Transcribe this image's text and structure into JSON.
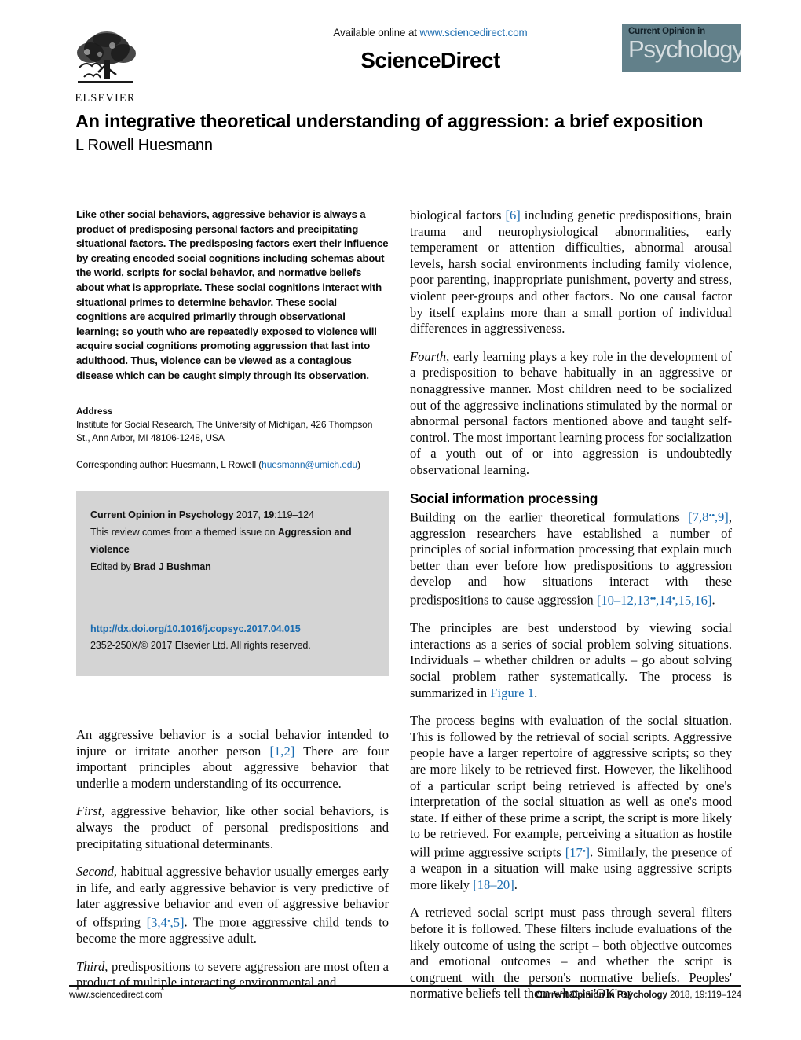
{
  "masthead": {
    "available_text": "Available online at ",
    "available_url": "www.sciencedirect.com",
    "sciencedirect_wordmark": "ScienceDirect",
    "elsevier_wordmark": "ELSEVIER",
    "journal_logo_top": "Current Opinion in",
    "journal_logo_main": "Psychology",
    "journal_logo_bg": "#62808a",
    "link_color": "#1b6cb0"
  },
  "title_block": {
    "title": "An integrative theoretical understanding of aggression: a brief exposition",
    "author": "L Rowell Huesmann"
  },
  "abstract": {
    "text": "Like other social behaviors, aggressive behavior is always a product of predisposing personal factors and precipitating situational factors. The predisposing factors exert their influence by creating encoded social cognitions including schemas about the world, scripts for social behavior, and normative beliefs about what is appropriate. These social cognitions interact with situational primes to determine behavior. These social cognitions are acquired primarily through observational learning; so youth who are repeatedly exposed to violence will acquire social cognitions promoting aggression that last into adulthood. Thus, violence can be viewed as a contagious disease which can be caught simply through its observation."
  },
  "address": {
    "heading": "Address",
    "body": "Institute for Social Research, The University of Michigan, 426 Thompson St., Ann Arbor, MI 48106-1248, USA",
    "corresponding_prefix": "Corresponding author: Huesmann, L Rowell (",
    "corresponding_email": "huesmann@umich.edu",
    "corresponding_suffix": ")"
  },
  "cite_box": {
    "journal_name": "Current Opinion in Psychology",
    "journal_year": " 2017, ",
    "volume": "19",
    "pages": ":119–124",
    "themed_prefix": "This review comes from a themed issue on ",
    "themed_issue": "Aggression and violence",
    "edited_prefix": "Edited by ",
    "editor": "Brad J Bushman",
    "doi": "http://dx.doi.org/10.1016/j.copsyc.2017.04.015",
    "rights": "2352-250X/© 2017 Elsevier Ltd. All rights reserved.",
    "background": "#d4d4d4"
  },
  "left_column_body": {
    "p1_a": "An aggressive behavior is a social behavior intended to injure or irritate another person ",
    "p1_ref": "[1,2]",
    "p1_b": " There are four important principles about aggressive behavior that underlie a modern understanding of its occurrence.",
    "p2_lead": "First",
    "p2_text": ", aggressive behavior, like other social behaviors, is always the product of personal predispositions and precipitating situational determinants.",
    "p3_lead": "Second",
    "p3_a": ", habitual aggressive behavior usually emerges early in life, and early aggressive behavior is very predictive of later aggressive behavior and even of aggressive behavior of offspring ",
    "p3_ref": "[3,4",
    "p3_ref_star": "•",
    "p3_ref_b": ",5]",
    "p3_b": ". The more aggressive child tends to become the more aggressive adult.",
    "p4_lead": "Third",
    "p4_text": ", predispositions to severe aggression are most often a product of multiple interacting environmental and"
  },
  "right_column_body": {
    "p1_a": "biological factors ",
    "p1_ref": "[6]",
    "p1_b": " including genetic predispositions, brain trauma and neurophysiological abnormalities, early temperament or attention difficulties, abnormal arousal levels, harsh social environments including family violence, poor parenting, inappropriate punishment, poverty and stress, violent peer-groups and other factors. No one causal factor by itself explains more than a small portion of individual differences in aggressiveness.",
    "p2_lead": "Fourth",
    "p2_text": ", early learning plays a key role in the development of a predisposition to behave habitually in an aggressive or nonaggressive manner. Most children need to be socialized out of the aggressive inclinations stimulated by the normal or abnormal personal factors mentioned above and taught self-control. The most important learning process for socialization of a youth out of or into aggression is undoubtedly observational learning.",
    "section_heading": "Social information processing",
    "p3_a": "Building on the earlier theoretical formulations ",
    "p3_ref1": "[7,8",
    "p3_ref1_star": "••",
    "p3_ref1_b": ",9]",
    "p3_b": ", aggression researchers have established a number of principles of social information processing that explain much better than ever before how predispositions to aggression develop and how situations interact with these predispositions to cause aggression ",
    "p3_ref2": "[10–12,13",
    "p3_ref2_star": "••",
    "p3_ref2_mid": ",14",
    "p3_ref2_star2": "•",
    "p3_ref2_end": ",15,16]",
    "p3_c": ".",
    "p4_a": "The principles are best understood by viewing social interactions as a series of social problem solving situations. Individuals – whether children or adults – go about solving social problem rather systematically. The process is summarized in ",
    "p4_figref": "Figure 1",
    "p4_b": ".",
    "p5_a": "The process begins with evaluation of the social situation. This is followed by the retrieval of social scripts. Aggressive people have a larger repertoire of aggressive scripts; so they are more likely to be retrieved first. However, the likelihood of a particular script being retrieved is affected by one's interpretation of the social situation as well as one's mood state. If either of these prime a script, the script is more likely to be retrieved. For example, perceiving a situation as hostile will prime aggressive scripts ",
    "p5_ref1": "[17",
    "p5_ref1_star": "•",
    "p5_ref1_b": "]",
    "p5_b": ". Similarly, the presence of a weapon in a situation will make using aggressive scripts more likely ",
    "p5_ref2": "[18–20]",
    "p5_c": ".",
    "p6_text": "A retrieved social script must pass through several filters before it is followed. These filters include evaluations of the likely outcome of using the script – both objective outcomes and emotional outcomes – and whether the script is congruent with the person's normative beliefs. Peoples' normative beliefs tell them what is 'OK' or"
  },
  "footer": {
    "left": "www.sciencedirect.com",
    "right_journal": "Current Opinion in Psychology",
    "right_rest": " 2018, 19:119–124"
  }
}
